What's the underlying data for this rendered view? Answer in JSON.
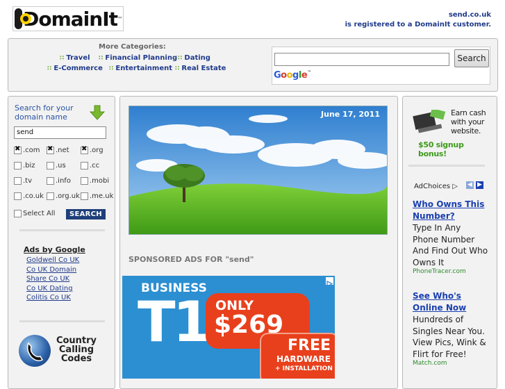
{
  "header": {
    "logo_text": "DomainIt",
    "logo_tm": "™",
    "domain": "send.co.uk",
    "registered_text": "is registered to a DomainIt customer."
  },
  "categories": {
    "title": "More Categories:",
    "items": [
      "Travel",
      "Financial Planning",
      "Dating",
      "E-Commerce",
      "Entertainment",
      "Real Estate"
    ]
  },
  "google_search": {
    "value": "",
    "button_label": "Search",
    "logo": "Google"
  },
  "domain_search": {
    "title_line1": "Search for your",
    "title_line2": "domain name",
    "input_value": "send",
    "tlds": [
      {
        "label": ".com",
        "checked": true
      },
      {
        "label": ".net",
        "checked": true
      },
      {
        "label": ".org",
        "checked": true
      },
      {
        "label": ".biz",
        "checked": false
      },
      {
        "label": ".us",
        "checked": false
      },
      {
        "label": ".cc",
        "checked": false
      },
      {
        "label": ".tv",
        "checked": false
      },
      {
        "label": ".info",
        "checked": false
      },
      {
        "label": ".mobi",
        "checked": false
      },
      {
        "label": ".co.uk",
        "checked": false
      },
      {
        "label": ".org.uk",
        "checked": false
      },
      {
        "label": ".me.uk",
        "checked": false
      }
    ],
    "select_all_label": "Select All",
    "search_button": "SEARCH"
  },
  "ads_by_google": {
    "title": "Ads by Google",
    "links": [
      "Goldwell Co UK",
      "Co UK Domain",
      "Share Co UK",
      "Co UK Dating",
      "Colitis Co UK"
    ]
  },
  "country_codes": {
    "line1": "Country",
    "line2": "Calling",
    "line3": "Codes"
  },
  "hero": {
    "date": "June 17, 2011"
  },
  "sponsored_title": "SPONSORED ADS FOR \"send\"",
  "banner": {
    "business": "BUSINESS",
    "product": "T1",
    "only": "ONLY",
    "price": "$269",
    "free": "FREE",
    "hardware": "HARDWARE",
    "installation": "+ INSTALLATION"
  },
  "earn_ad": {
    "line1": "Earn cash",
    "line2": "with your",
    "line3": "website.",
    "bonus": "$50 signup bonus!"
  },
  "right_ads": {
    "adchoices": "AdChoices",
    "ads": [
      {
        "title": "Who Owns This Number?",
        "text": "Type In Any Phone Number And Find Out Who Owns It",
        "url": "PhoneTracer.com"
      },
      {
        "title": "See Who's Online Now",
        "text": "Hundreds of Singles Near You. View Pics, Wink & Flirt for Free!",
        "url": "Match.com"
      }
    ]
  },
  "colors": {
    "link_blue": "#1f3a8a",
    "ad_blue": "#1a3fb0",
    "panel_bg": "#f2f2f2",
    "search_btn": "#1f3f7a",
    "arrow_green": "#7ab82e"
  }
}
